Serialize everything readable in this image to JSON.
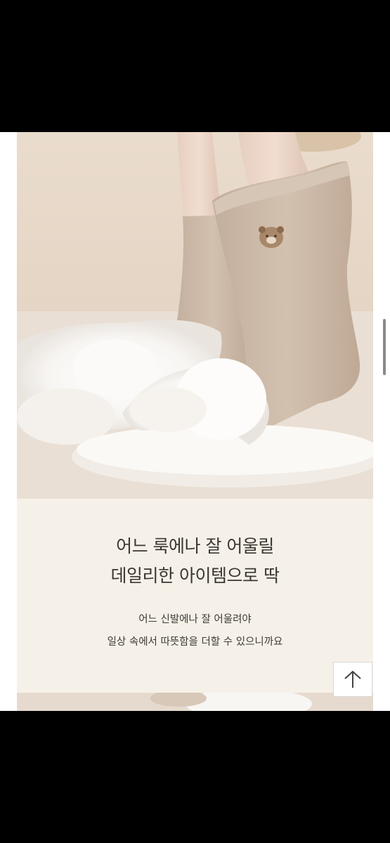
{
  "product_section": {
    "headline_line1": "어느 룩에나 잘 어울릴",
    "headline_line2": "데일리한 아이템으로 딱",
    "body_line1": "어느 신발에나  잘 어울려야",
    "body_line2": "일상 속에서 따뜻함을 더할 수 있으니까요"
  },
  "controls": {
    "scroll_top_icon": "arrow-up-icon"
  },
  "colors": {
    "panel_bg": "#f6f1e8",
    "text": "#3b3631",
    "sock": "#cbb8a7"
  }
}
